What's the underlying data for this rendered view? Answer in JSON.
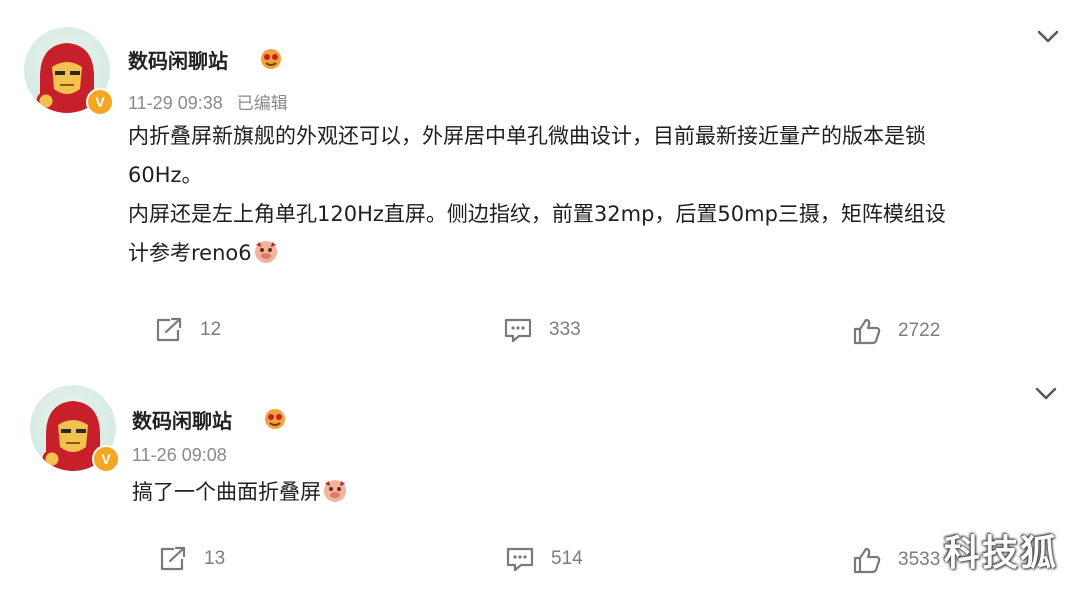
{
  "posts": [
    {
      "author": "数码闲聊站",
      "author_badge_icon": "emoji-face-icon",
      "verified_badge": "V",
      "time": "11-29 09:38",
      "edited_label": "已编辑",
      "lines": [
        "内折叠屏新旗舰的外观还可以，外屏居中单孔微曲设计，目前最新接近量产的版本是锁",
        "60Hz。",
        "内屏还是左上角单孔120Hz直屏。侧边指纹，前置32mp，后置50mp三摄，矩阵模组设",
        "计参考reno6"
      ],
      "repost_count": "12",
      "comment_count": "333",
      "like_count": "2722"
    },
    {
      "author": "数码闲聊站",
      "author_badge_icon": "emoji-face-icon",
      "verified_badge": "V",
      "time": "11-26 09:08",
      "lines": [
        "搞了一个曲面折叠屏"
      ],
      "repost_count": "13",
      "comment_count": "514",
      "like_count": "3533"
    }
  ],
  "watermark": "科技狐",
  "colors": {
    "text": "#1f1f1f",
    "meta": "#8a8a8a",
    "verified": "#f5a623",
    "ironman_red": "#c8202a",
    "ironman_gold": "#f2c14e"
  }
}
